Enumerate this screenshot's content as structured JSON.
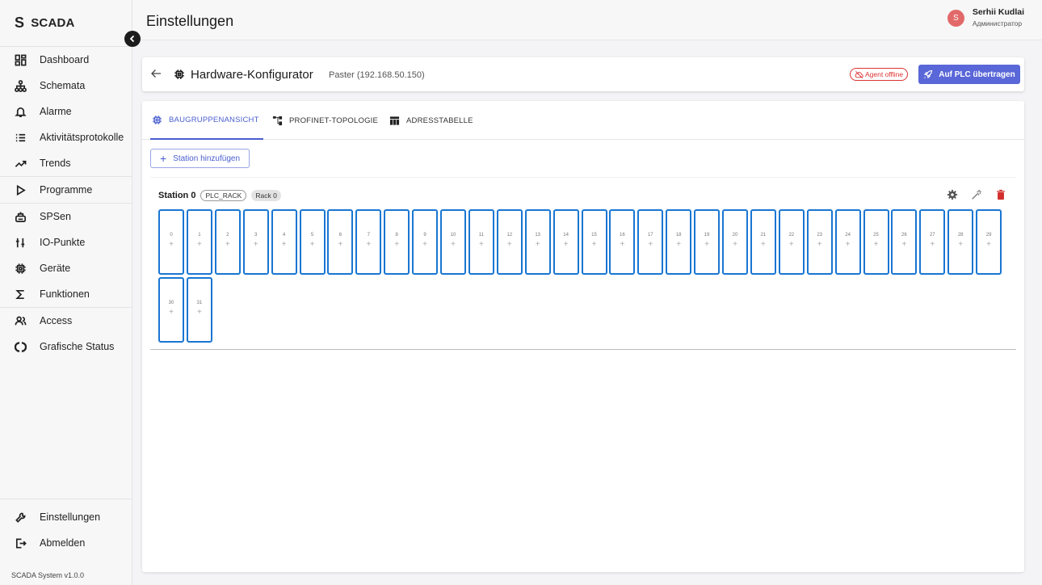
{
  "brand": {
    "logo": "S",
    "name": "SCADA"
  },
  "sidebar": {
    "items": [
      {
        "label": "Dashboard",
        "icon": "dashboard-icon"
      },
      {
        "label": "Schemata",
        "icon": "hierarchy-icon"
      },
      {
        "label": "Alarme",
        "icon": "bell-icon"
      },
      {
        "label": "Aktivitätsprotokolle",
        "icon": "list-icon"
      },
      {
        "label": "Trends",
        "icon": "trend-icon"
      },
      {
        "label": "Programme",
        "icon": "play-icon"
      },
      {
        "label": "SPSen",
        "icon": "plc-icon"
      },
      {
        "label": "IO-Punkte",
        "icon": "io-icon"
      },
      {
        "label": "Geräte",
        "icon": "chip-icon"
      },
      {
        "label": "Funktionen",
        "icon": "sigma-icon"
      },
      {
        "label": "Access",
        "icon": "users-icon"
      },
      {
        "label": "Grafische Status",
        "icon": "status-icon"
      }
    ],
    "bottom": [
      {
        "label": "Einstellungen",
        "icon": "wrench-icon"
      },
      {
        "label": "Abmelden",
        "icon": "logout-icon"
      }
    ],
    "version": "SCADA System v1.0.0"
  },
  "header": {
    "title": "Einstellungen",
    "user": {
      "initial": "S",
      "name": "Serhii Kudlai",
      "role": "Администратор"
    }
  },
  "config": {
    "title": "Hardware-Konfigurator",
    "subtitle": "Paster (192.168.50.150)",
    "agent_status": "Agent offline",
    "upload_label": "Auf PLC übertragen"
  },
  "tabs": [
    {
      "label": "BAUGRUPPENANSICHT",
      "active": true
    },
    {
      "label": "PROFINET-TOPOLOGIE",
      "active": false
    },
    {
      "label": "ADRESSTABELLE",
      "active": false
    }
  ],
  "add_station_label": "Station hinzufügen",
  "station": {
    "name": "Station 0",
    "type_chip": "PLC_RACK",
    "rack_chip": "Rack 0",
    "slots": [
      "0",
      "1",
      "2",
      "3",
      "4",
      "5",
      "6",
      "7",
      "8",
      "9",
      "10",
      "11",
      "12",
      "13",
      "14",
      "15",
      "16",
      "17",
      "18",
      "19",
      "20",
      "21",
      "22",
      "23",
      "24",
      "25",
      "26",
      "27",
      "28",
      "29",
      "30",
      "31"
    ],
    "slot_add_symbol": "+"
  },
  "colors": {
    "accent": "#4a5ed0",
    "slot_border": "#1976d2",
    "danger": "#d32f2f",
    "avatar": "#e26969"
  }
}
